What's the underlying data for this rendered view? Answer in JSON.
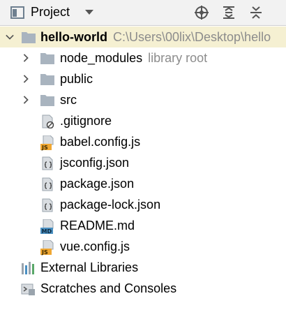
{
  "toolbar": {
    "title": "Project",
    "icons": [
      "project-view-icon",
      "dropdown-arrow-icon",
      "locate-icon",
      "expand-all-icon",
      "collapse-all-icon"
    ]
  },
  "tree": {
    "root": {
      "name": "hello-world",
      "path": "C:\\Users\\00lix\\Desktop\\hello"
    },
    "folders": [
      {
        "name": "node_modules",
        "sub": "library root"
      },
      {
        "name": "public"
      },
      {
        "name": "src"
      }
    ],
    "files": [
      {
        "name": ".gitignore",
        "icon": "gitignore-file-icon"
      },
      {
        "name": "babel.config.js",
        "icon": "js-file-icon",
        "badge": "JS"
      },
      {
        "name": "jsconfig.json",
        "icon": "json-file-icon"
      },
      {
        "name": "package.json",
        "icon": "json-file-icon"
      },
      {
        "name": "package-lock.json",
        "icon": "json-file-icon"
      },
      {
        "name": "README.md",
        "icon": "md-file-icon",
        "badge": "MD"
      },
      {
        "name": "vue.config.js",
        "icon": "js-file-icon",
        "badge": "JS"
      }
    ],
    "external": "External Libraries",
    "scratches": "Scratches and Consoles"
  },
  "colors": {
    "selected_row": "#f5f0d2",
    "folder": "#a9b4bf",
    "js_badge": "#f0a732",
    "md_badge": "#4a90c2"
  }
}
